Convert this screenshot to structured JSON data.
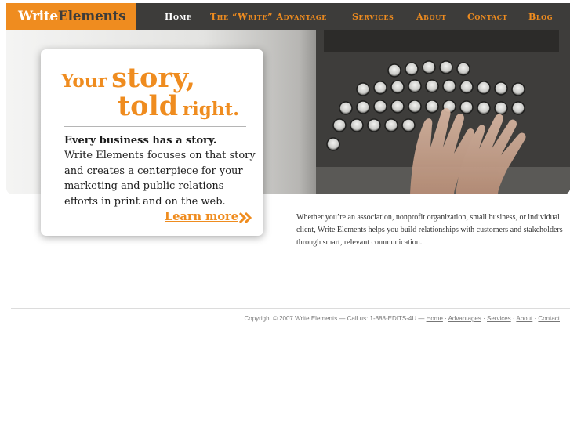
{
  "brand": {
    "name_part1": "Write",
    "name_part2": "Elements"
  },
  "nav": [
    {
      "label": "Home",
      "active": true
    },
    {
      "label": "The “Write” Advantage",
      "active": false
    },
    {
      "label": "Services",
      "active": false
    },
    {
      "label": "About",
      "active": false
    },
    {
      "label": "Contact",
      "active": false
    },
    {
      "label": "Blog",
      "active": false
    }
  ],
  "hero": {
    "headline_line1_small": "Your",
    "headline_line1_big": "story,",
    "headline_line2_big": "told",
    "headline_line2_small": "right.",
    "body_lead": "Every business has a story.",
    "body_text": "Write Elements focuses on that story and creates a centerpiece for your marketing and public relations efforts in print and on the web.",
    "learn_more_label": "Learn more",
    "learn_more_icon": "double-chevron-right-icon"
  },
  "intro": "Whether you’re an association, nonprofit organization, small business, or individual client, Write Elements helps you build relationships with customers and stakeholders through smart, relevant communication.",
  "footer": {
    "copyright": "Copyright © 2007 Write Elements — Call us: 1-888-EDITS-4U —",
    "links": [
      "Home",
      "Advantages",
      "Services",
      "About",
      "Contact"
    ],
    "separator": "·"
  },
  "colors": {
    "accent": "#ef8c1f",
    "header_bg": "#3d3c3a",
    "text": "#1c1c1c"
  }
}
